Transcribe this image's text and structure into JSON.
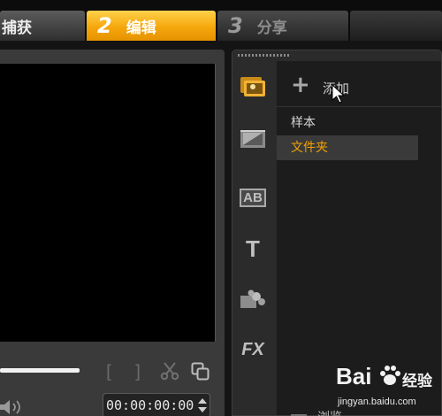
{
  "steps": {
    "capture": {
      "label": "捕获"
    },
    "edit": {
      "number": "2",
      "label": "编辑"
    },
    "share": {
      "number": "3",
      "label": "分享"
    }
  },
  "preview": {
    "bracket_in": "[",
    "bracket_out": "]",
    "timecode": "00:00:00:00"
  },
  "library": {
    "add_label": "添加",
    "folders": [
      "样本",
      "文件夹"
    ],
    "selected_folder": "文件夹",
    "browse_label": "浏览",
    "icons": [
      "media-icon",
      "transition-icon",
      "title-ab-icon",
      "text-t-icon",
      "graphic-icon",
      "fx-icon"
    ],
    "title_icon_text": "AB",
    "text_icon_text": "T",
    "fx_icon_text": "FX"
  },
  "colors": {
    "accent": "#f5a70c",
    "selected_text": "#f4a100"
  },
  "watermark": {
    "logo": "Bai",
    "logo_suffix": "经验",
    "url": "jingyan.baidu.com"
  }
}
